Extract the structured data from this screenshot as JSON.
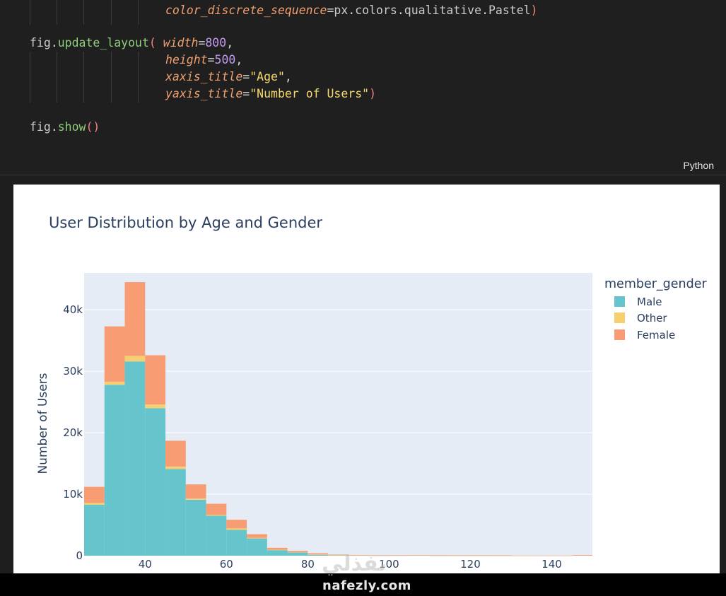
{
  "code": {
    "line0": {
      "param": "color_discrete_sequence",
      "eq": "=",
      "val": "px",
      "dot1": ".",
      "colors": "colors",
      "dot2": ".",
      "qual": "qualitative",
      "dot3": ".",
      "pastel": "Pastel",
      "close": ")"
    },
    "line1": {
      "obj": "fig",
      "dot": ".",
      "method": "update_layout",
      "open": "(",
      "param": "width",
      "eq": "=",
      "val": "800",
      "comma": ","
    },
    "line2": {
      "param": "height",
      "eq": "=",
      "val": "500",
      "comma": ","
    },
    "line3": {
      "param": "xaxis_title",
      "eq": "=",
      "val": "\"Age\"",
      "comma": ","
    },
    "line4": {
      "param": "yaxis_title",
      "eq": "=",
      "val": "\"Number of Users\"",
      "close": ")"
    },
    "line5": {
      "obj": "fig",
      "dot": ".",
      "method": "show",
      "parens": "()"
    },
    "language": "Python"
  },
  "legend": {
    "title": "member_gender",
    "items": [
      {
        "label": "Male",
        "color": "#66c5cc"
      },
      {
        "label": "Other",
        "color": "#f6cf71"
      },
      {
        "label": "Female",
        "color": "#f89c74"
      }
    ]
  },
  "chart_data": {
    "type": "bar",
    "title": "User Distribution by Age and Gender",
    "xlabel": "",
    "ylabel": "Number of Users",
    "xlim": [
      25,
      150
    ],
    "ylim": [
      0,
      46000
    ],
    "x_ticks": [
      40,
      60,
      80,
      100,
      120,
      140
    ],
    "x_tick_labels": [
      "40",
      "60",
      "80",
      "100",
      "120",
      "140"
    ],
    "y_ticks": [
      0,
      10000,
      20000,
      30000,
      40000
    ],
    "y_tick_labels": [
      "0",
      "10k",
      "20k",
      "30k",
      "40k"
    ],
    "bin_width": 5,
    "bins_start": [
      25,
      30,
      35,
      40,
      45,
      50,
      55,
      60,
      65,
      70,
      75,
      80,
      85,
      90,
      95,
      100,
      105,
      110,
      115,
      120,
      125,
      130,
      135,
      140,
      145
    ],
    "series": [
      {
        "name": "Male",
        "values": [
          8300,
          27800,
          31600,
          24000,
          14100,
          9100,
          6500,
          4200,
          2800,
          900,
          550,
          150,
          80,
          60,
          40,
          50,
          60,
          30,
          20,
          20,
          20,
          0,
          0,
          0,
          0
        ]
      },
      {
        "name": "Other",
        "values": [
          300,
          500,
          900,
          600,
          400,
          200,
          150,
          250,
          100,
          80,
          50,
          50,
          20,
          10,
          10,
          10,
          10,
          10,
          10,
          10,
          10,
          0,
          0,
          0,
          0
        ]
      },
      {
        "name": "Female",
        "values": [
          2600,
          9000,
          12000,
          8000,
          4200,
          2300,
          1800,
          1400,
          600,
          300,
          200,
          200,
          80,
          40,
          30,
          20,
          20,
          40,
          30,
          40,
          30,
          20,
          20,
          20,
          100
        ]
      }
    ],
    "grid": true,
    "legend_position": "right"
  },
  "watermark": {
    "text": "nafezly.com",
    "arabic": "نفذلي"
  },
  "colors": {
    "plot_bg": "#e5ecf6",
    "grid": "#ffffff",
    "axis_text": "#2a3f5f"
  }
}
